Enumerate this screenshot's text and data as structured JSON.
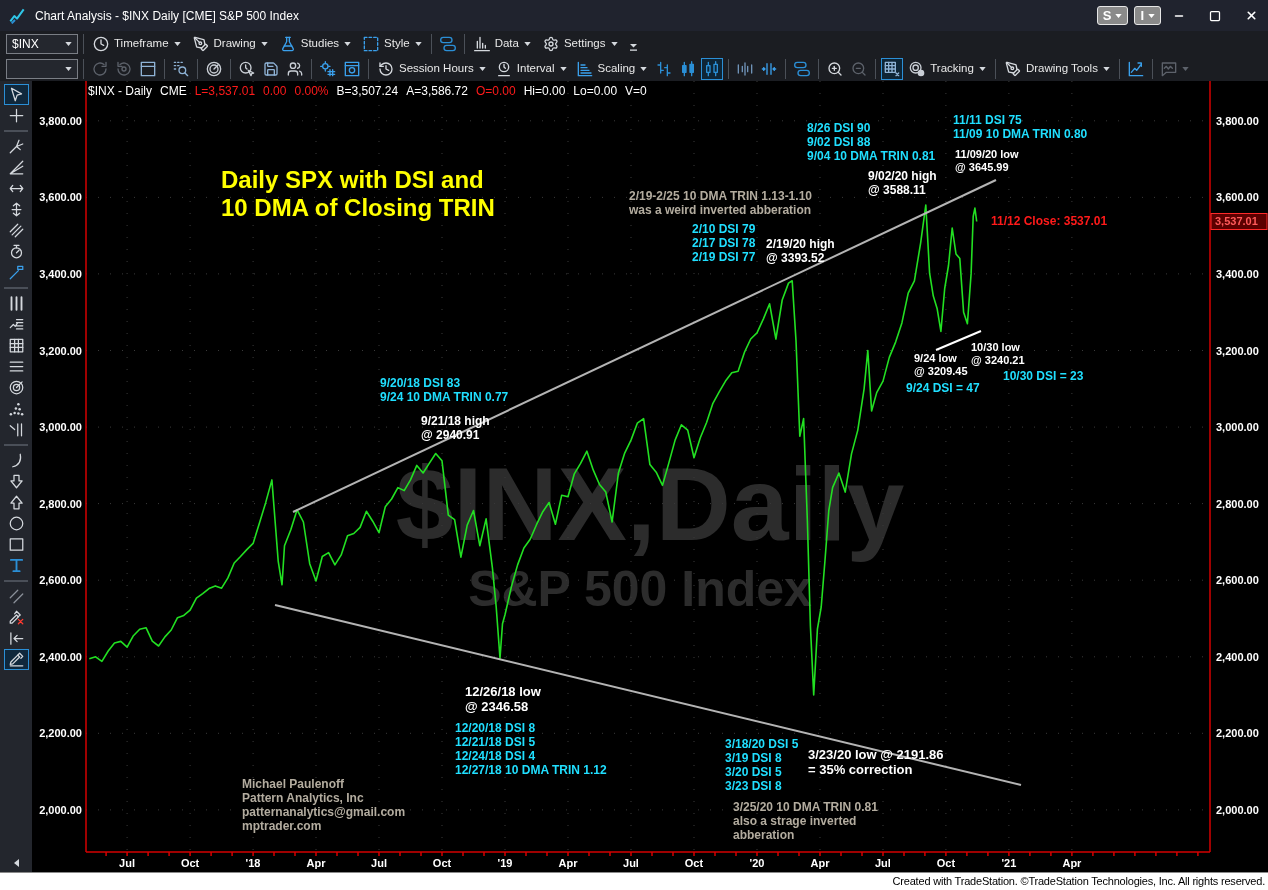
{
  "window": {
    "title": "Chart Analysis - $INX Daily [CME] S&P 500 Index",
    "menu_buttons": [
      "S",
      "I"
    ]
  },
  "toolbar_1": {
    "symbol": "$INX",
    "groups": [
      {
        "items": [
          {
            "kind": "clock",
            "label": "Timeframe",
            "dropdown": true
          },
          {
            "kind": "pen",
            "label": "Drawing",
            "dropdown": true
          },
          {
            "kind": "flask",
            "label": "Studies",
            "dropdown": true
          },
          {
            "kind": "style",
            "label": "Style",
            "dropdown": true
          }
        ]
      },
      {
        "items": [
          {
            "kind": "link",
            "dropdown": false
          }
        ]
      },
      {
        "items": [
          {
            "kind": "databars",
            "label": "Data",
            "dropdown": true
          },
          {
            "kind": "gear",
            "label": "Settings",
            "dropdown": true
          }
        ]
      }
    ]
  },
  "toolbar_2": {
    "groups": [
      {
        "items": [
          {
            "kind": "refresh",
            "selected": false,
            "disabled": true,
            "dropdown": false
          },
          {
            "kind": "reload",
            "selected": false,
            "disabled": true,
            "dropdown": false
          },
          {
            "kind": "window",
            "selected": false,
            "disabled": false,
            "dropdown": false
          }
        ]
      },
      {
        "items": [
          {
            "kind": "scan",
            "selected": false,
            "disabled": false,
            "dropdown": false
          }
        ]
      },
      {
        "items": [
          {
            "kind": "radar",
            "selected": false,
            "disabled": false,
            "dropdown": false
          }
        ]
      },
      {
        "items": [
          {
            "kind": "alarm",
            "selected": false,
            "disabled": false,
            "dropdown": false
          },
          {
            "kind": "save",
            "selected": false,
            "disabled": false,
            "dropdown": false
          },
          {
            "kind": "people",
            "selected": false,
            "disabled": false,
            "dropdown": false
          }
        ]
      },
      {
        "items": [
          {
            "kind": "gearhash",
            "selected": false,
            "disabled": false,
            "dropdown": false
          },
          {
            "kind": "windowgear",
            "selected": false,
            "disabled": false,
            "dropdown": false
          }
        ]
      },
      {
        "items": [
          {
            "kind": "session",
            "label": "Session Hours",
            "selected": false,
            "disabled": false,
            "dropdown": true
          },
          {
            "kind": "interval",
            "label": "Interval",
            "selected": false,
            "disabled": false,
            "dropdown": true
          },
          {
            "kind": "scaling",
            "label": "Scaling",
            "selected": false,
            "disabled": false,
            "dropdown": true
          },
          {
            "kind": "ohlc",
            "selected": false,
            "disabled": false,
            "dropdown": false
          },
          {
            "kind": "candles",
            "selected": false,
            "disabled": false,
            "dropdown": false
          },
          {
            "kind": "hollow",
            "selected": true,
            "disabled": false,
            "dropdown": false
          }
        ]
      },
      {
        "items": [
          {
            "kind": "compress",
            "selected": false,
            "disabled": false,
            "dropdown": false
          },
          {
            "kind": "expand",
            "selected": false,
            "disabled": false,
            "dropdown": false
          }
        ]
      },
      {
        "items": [
          {
            "kind": "link",
            "selected": false,
            "disabled": false,
            "dropdown": false
          }
        ]
      },
      {
        "items": [
          {
            "kind": "zoomin",
            "selected": false,
            "disabled": false,
            "dropdown": false
          },
          {
            "kind": "zoomout",
            "selected": false,
            "disabled": true,
            "dropdown": false
          }
        ]
      },
      {
        "items": [
          {
            "kind": "gridx",
            "selected": true,
            "disabled": false,
            "dropdown": false
          },
          {
            "kind": "tracking",
            "label": "Tracking",
            "selected": false,
            "disabled": false,
            "dropdown": true
          }
        ]
      },
      {
        "items": [
          {
            "kind": "drawtools",
            "label": "Drawing Tools",
            "selected": false,
            "disabled": false,
            "dropdown": true
          }
        ]
      },
      {
        "items": [
          {
            "kind": "chartup",
            "selected": false,
            "disabled": false,
            "dropdown": false
          }
        ]
      },
      {
        "items": [
          {
            "kind": "chat",
            "selected": false,
            "disabled": true,
            "dropdown": true
          }
        ]
      }
    ]
  },
  "left_toolbar": {
    "groups": [
      {
        "items": [
          {
            "kind": "pointer",
            "selected": true
          },
          {
            "kind": "crosshair",
            "selected": false
          }
        ]
      },
      {
        "items": [
          {
            "kind": "pitchfork",
            "selected": false
          },
          {
            "kind": "fan",
            "selected": false
          },
          {
            "kind": "hruler",
            "selected": false
          },
          {
            "kind": "vruler",
            "selected": false
          },
          {
            "kind": "lines",
            "selected": false
          },
          {
            "kind": "cycle",
            "selected": false
          },
          {
            "kind": "brush",
            "selected": false
          }
        ]
      },
      {
        "items": [
          {
            "kind": "bars",
            "selected": false
          },
          {
            "kind": "fibext",
            "selected": false
          },
          {
            "kind": "grid",
            "selected": false
          },
          {
            "kind": "levels",
            "selected": false
          },
          {
            "kind": "target",
            "selected": false
          },
          {
            "kind": "dots",
            "selected": false
          },
          {
            "kind": "speed",
            "selected": false
          }
        ]
      },
      {
        "items": [
          {
            "kind": "arc",
            "selected": false
          },
          {
            "kind": "downarrow",
            "selected": false
          },
          {
            "kind": "uparrow",
            "selected": false
          },
          {
            "kind": "ellipse",
            "selected": false
          },
          {
            "kind": "rectangle",
            "selected": false
          },
          {
            "kind": "text",
            "selected": false
          }
        ]
      },
      {
        "items": [
          {
            "kind": "channel",
            "selected": false
          },
          {
            "kind": "erase",
            "selected": false
          },
          {
            "kind": "goto",
            "selected": false
          },
          {
            "kind": "pen",
            "selected": true
          }
        ]
      }
    ]
  },
  "chart": {
    "header": [
      {
        "text": "$INX - Daily",
        "color": "#ffffff"
      },
      {
        "text": "CME",
        "color": "#ffffff"
      },
      {
        "text": "L=3,537.01",
        "color": "#ff1a1a"
      },
      {
        "text": "0.00",
        "color": "#ff1a1a"
      },
      {
        "text": "0.00%",
        "color": "#ff1a1a"
      },
      {
        "text": "B=3,507.24",
        "color": "#ffffff"
      },
      {
        "text": "A=3,586.72",
        "color": "#ffffff"
      },
      {
        "text": "O=0.00",
        "color": "#ff1a1a"
      },
      {
        "text": "Hi=0.00",
        "color": "#ffffff"
      },
      {
        "text": "Lo=0.00",
        "color": "#ffffff"
      },
      {
        "text": "V=0",
        "color": "#ffffff"
      }
    ],
    "watermark": [
      "$INX,Daily",
      "S&P 500 Index"
    ],
    "chart_data": {
      "type": "line",
      "grid": true,
      "x": [
        2017.35,
        2017.375,
        2017.4,
        2017.425,
        2017.45,
        2017.475,
        2017.5,
        2017.525,
        2017.55,
        2017.575,
        2017.6,
        2017.625,
        2017.65,
        2017.675,
        2017.7,
        2017.725,
        2017.75,
        2017.775,
        2017.8,
        2017.825,
        2017.85,
        2017.875,
        2017.9,
        2017.925,
        2017.95,
        2017.975,
        2018.0,
        2018.025,
        2018.05,
        2018.075,
        2018.1,
        2018.115,
        2018.125,
        2018.15,
        2018.175,
        2018.2,
        2018.225,
        2018.25,
        2018.275,
        2018.3,
        2018.325,
        2018.35,
        2018.375,
        2018.4,
        2018.425,
        2018.45,
        2018.475,
        2018.5,
        2018.525,
        2018.55,
        2018.575,
        2018.6,
        2018.625,
        2018.65,
        2018.675,
        2018.7,
        2018.725,
        2018.75,
        2018.775,
        2018.8,
        2018.825,
        2018.85,
        2018.875,
        2018.9,
        2018.925,
        2018.95,
        2018.965,
        2018.98,
        2018.99,
        2019.0,
        2019.025,
        2019.05,
        2019.075,
        2019.1,
        2019.125,
        2019.15,
        2019.175,
        2019.2,
        2019.225,
        2019.25,
        2019.275,
        2019.3,
        2019.325,
        2019.35,
        2019.375,
        2019.4,
        2019.425,
        2019.45,
        2019.475,
        2019.5,
        2019.525,
        2019.55,
        2019.575,
        2019.6,
        2019.625,
        2019.65,
        2019.675,
        2019.7,
        2019.725,
        2019.75,
        2019.775,
        2019.8,
        2019.825,
        2019.85,
        2019.875,
        2019.9,
        2019.925,
        2019.95,
        2019.975,
        2020.0,
        2020.025,
        2020.05,
        2020.075,
        2020.1,
        2020.125,
        2020.14,
        2020.155,
        2020.17,
        2020.185,
        2020.2,
        2020.212,
        2020.225,
        2020.24,
        2020.255,
        2020.27,
        2020.285,
        2020.3,
        2020.325,
        2020.35,
        2020.375,
        2020.4,
        2020.425,
        2020.44,
        2020.455,
        2020.475,
        2020.5,
        2020.525,
        2020.55,
        2020.575,
        2020.6,
        2020.625,
        2020.65,
        2020.67,
        2020.685,
        2020.7,
        2020.715,
        2020.73,
        2020.745,
        2020.76,
        2020.775,
        2020.79,
        2020.805,
        2020.82,
        2020.835,
        2020.85,
        2020.858,
        2020.865,
        2020.872
      ],
      "series": [
        {
          "color": "#22e022",
          "values": [
            2395,
            2400,
            2388,
            2415,
            2436,
            2440,
            2425,
            2455,
            2472,
            2476,
            2441,
            2428,
            2452,
            2470,
            2502,
            2508,
            2522,
            2553,
            2565,
            2578,
            2585,
            2579,
            2606,
            2645,
            2662,
            2680,
            2696,
            2748,
            2802,
            2862,
            2650,
            2588,
            2690,
            2732,
            2784,
            2752,
            2643,
            2598,
            2662,
            2672,
            2640,
            2666,
            2716,
            2722,
            2738,
            2780,
            2754,
            2724,
            2792,
            2812,
            2842,
            2834,
            2862,
            2900,
            2880,
            2906,
            2931,
            2912,
            2770,
            2758,
            2660,
            2744,
            2782,
            2690,
            2760,
            2632,
            2530,
            2396,
            2486,
            2510,
            2582,
            2640,
            2684,
            2707,
            2745,
            2779,
            2803,
            2746,
            2822,
            2818,
            2878,
            2905,
            2937,
            2888,
            2850,
            2830,
            2752,
            2880,
            2932,
            2966,
            3010,
            3022,
            2902,
            2882,
            2848,
            2906,
            2966,
            3006,
            2992,
            2920,
            2972,
            3012,
            3062,
            3092,
            3120,
            3142,
            3146,
            3195,
            3230,
            3246,
            3282,
            3322,
            3230,
            3332,
            3376,
            3382,
            3226,
            2976,
            3022,
            2752,
            2480,
            2300,
            2472,
            2530,
            2652,
            2782,
            2842,
            2880,
            2830,
            2930,
            2992,
            3100,
            3200,
            3042,
            3090,
            3120,
            3182,
            3222,
            3272,
            3350,
            3382,
            3482,
            3580,
            3402,
            3342,
            3310,
            3250,
            3362,
            3422,
            3520,
            3452,
            3440,
            3300,
            3270,
            3400,
            3550,
            3572,
            3537
          ]
        }
      ],
      "xlim": [
        2017.337,
        2021.798
      ],
      "ylim": [
        1890,
        3904
      ],
      "xticks": [
        {
          "value": 2017.5,
          "label": "Jul"
        },
        {
          "value": 2017.75,
          "label": "Oct"
        },
        {
          "value": 2018.0,
          "label": "'18"
        },
        {
          "value": 2018.25,
          "label": "Apr"
        },
        {
          "value": 2018.5,
          "label": "Jul"
        },
        {
          "value": 2018.75,
          "label": "Oct"
        },
        {
          "value": 2019.0,
          "label": "'19"
        },
        {
          "value": 2019.25,
          "label": "Apr"
        },
        {
          "value": 2019.5,
          "label": "Jul"
        },
        {
          "value": 2019.75,
          "label": "Oct"
        },
        {
          "value": 2020.0,
          "label": "'20"
        },
        {
          "value": 2020.25,
          "label": "Apr"
        },
        {
          "value": 2020.5,
          "label": "Jul"
        },
        {
          "value": 2020.75,
          "label": "Oct"
        },
        {
          "value": 2021.0,
          "label": "'21"
        },
        {
          "value": 2021.25,
          "label": "Apr"
        }
      ],
      "yticks": [
        {
          "value": 3800,
          "label": "3,800.00"
        },
        {
          "value": 3600,
          "label": "3,600.00"
        },
        {
          "value": 3400,
          "label": "3,400.00"
        },
        {
          "value": 3200,
          "label": "3,200.00"
        },
        {
          "value": 3000,
          "label": "3,000.00"
        },
        {
          "value": 2800,
          "label": "2,800.00"
        },
        {
          "value": 2600,
          "label": "2,600.00"
        },
        {
          "value": 2400,
          "label": "2,400.00"
        },
        {
          "value": 2200,
          "label": "2,200.00"
        },
        {
          "value": 2000,
          "label": "2,000.00"
        }
      ]
    },
    "notes": [
      {
        "lines": [
          "11/11 DSI 75",
          "11/09 10 DMA TRIN 0.80"
        ],
        "color": "#20dfff"
      },
      {
        "lines": [
          "8/26 DSI 90",
          "9/02 DSI 88",
          "9/04 10 DMA TRIN 0.81"
        ],
        "color": "#20dfff"
      },
      {
        "lines": [
          "11/09/20 low",
          "@ 3645.99"
        ],
        "color": "#ffffff"
      },
      {
        "lines": [
          "Daily SPX with DSI and",
          "10 DMA of Closing TRIN"
        ],
        "color": "#ffff00"
      },
      {
        "lines": [
          "9/02/20 high",
          "@ 3588.11"
        ],
        "color": "#ffffff"
      },
      {
        "lines": [
          "2/19-2/25 10 DMA TRIN 1.13-1.10",
          "was a weird inverted abberation"
        ],
        "color": "#b3ac9f"
      },
      {
        "lines": [
          "11/12 Close: 3537.01"
        ],
        "color": "#ff1a1a"
      },
      {
        "lines": [
          "2/10 DSI 79",
          "2/17 DSI 78",
          "2/19 DSI 77"
        ],
        "color": "#20dfff"
      },
      {
        "lines": [
          "2/19/20 high",
          "@ 3393.52"
        ],
        "color": "#ffffff"
      },
      {
        "lines": [
          "10/30 low",
          "@ 3240.21"
        ],
        "color": "#ffffff"
      },
      {
        "lines": [
          "9/24 low",
          "@ 3209.45"
        ],
        "color": "#ffffff"
      },
      {
        "lines": [
          "10/30 DSI = 23"
        ],
        "color": "#20dfff"
      },
      {
        "lines": [
          "9/20/18 DSI 83",
          "9/24 10 DMA TRIN 0.77"
        ],
        "color": "#20dfff"
      },
      {
        "lines": [
          "9/24 DSI = 47"
        ],
        "color": "#20dfff"
      },
      {
        "lines": [
          "9/21/18 high",
          "@ 2940.91"
        ],
        "color": "#ffffff"
      },
      {
        "lines": [
          "12/26/18 low",
          "@ 2346.58"
        ],
        "color": "#ffffff"
      },
      {
        "lines": [
          "12/20/18 DSI 8",
          "12/21/18 DSI 5",
          "12/24/18 DSI 4",
          "12/27/18 10 DMA TRIN 1.12"
        ],
        "color": "#20dfff"
      },
      {
        "lines": [
          "3/18/20 DSI 5",
          "3/19 DSI 8",
          "3/20 DSI 5",
          "3/23 DSI 8"
        ],
        "color": "#20dfff"
      },
      {
        "lines": [
          "3/23/20 low @ 2191.86",
          "= 35% correction"
        ],
        "color": "#ffffff"
      },
      {
        "lines": [
          "Michael Paulenoff",
          "Pattern Analytics, Inc",
          "patternanalytics@gmail.com",
          "mptrader.com"
        ],
        "color": "#b3ac9f"
      },
      {
        "lines": [
          "3/25/20 10 DMA TRIN 0.81",
          "also a strage inverted",
          "abberation"
        ],
        "color": "#b3ac9f"
      }
    ],
    "right_axis": {
      "labels": [
        "3,800.00",
        "3,600.00",
        "3,400.00",
        "3,200.00",
        "3,000.00",
        "2,800.00",
        "2,600.00",
        "2,400.00",
        "2,200.00",
        "2,000.00"
      ],
      "last_price": "3,537.01"
    }
  },
  "footer": "Created with TradeStation. ©TradeStation Technologies, Inc. All rights reserved."
}
